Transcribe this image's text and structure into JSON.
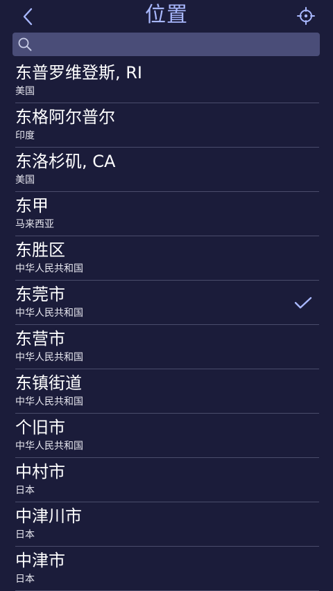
{
  "header": {
    "title": "位置",
    "back_icon": "chevron-left-icon",
    "locate_icon": "crosshair-icon"
  },
  "search": {
    "value": "",
    "placeholder": "",
    "icon": "search-icon"
  },
  "colors": {
    "background": "#1b1c3a",
    "title": "#a9b8ff",
    "search_bg": "#4a4d78",
    "divider": "#4b4d6c",
    "check": "#a9b8ff"
  },
  "locations": [
    {
      "name": "东普罗维登斯, RI",
      "country": "美国",
      "selected": false
    },
    {
      "name": "东格阿尔普尔",
      "country": "印度",
      "selected": false
    },
    {
      "name": "东洛杉矶, CA",
      "country": "美国",
      "selected": false
    },
    {
      "name": "东甲",
      "country": "马来西亚",
      "selected": false
    },
    {
      "name": "东胜区",
      "country": "中华人民共和国",
      "selected": false
    },
    {
      "name": "东莞市",
      "country": "中华人民共和国",
      "selected": true
    },
    {
      "name": "东营市",
      "country": "中华人民共和国",
      "selected": false
    },
    {
      "name": "东镇街道",
      "country": "中华人民共和国",
      "selected": false
    },
    {
      "name": "个旧市",
      "country": "中华人民共和国",
      "selected": false
    },
    {
      "name": "中村市",
      "country": "日本",
      "selected": false
    },
    {
      "name": "中津川市",
      "country": "日本",
      "selected": false
    },
    {
      "name": "中津市",
      "country": "日本",
      "selected": false
    }
  ]
}
